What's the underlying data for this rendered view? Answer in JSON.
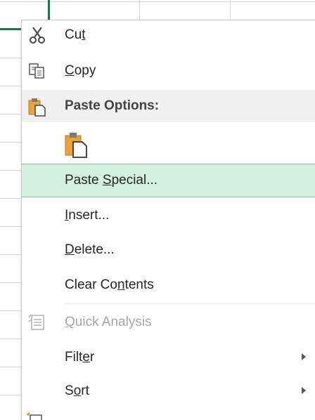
{
  "menu": {
    "items": [
      {
        "id": "cut",
        "pre": "Cu",
        "key": "t",
        "post": "",
        "icon": "scissors-icon"
      },
      {
        "id": "copy",
        "pre": "",
        "key": "C",
        "post": "opy",
        "icon": "copy-icon"
      },
      {
        "id": "paste_options",
        "pre": "Paste Options:",
        "key": "",
        "post": "",
        "icon": "clipboard-icon"
      },
      {
        "id": "paste_special",
        "pre": "Paste ",
        "key": "S",
        "post": "pecial...",
        "icon": ""
      },
      {
        "id": "insert",
        "pre": "",
        "key": "I",
        "post": "nsert...",
        "icon": ""
      },
      {
        "id": "delete",
        "pre": "",
        "key": "D",
        "post": "elete...",
        "icon": ""
      },
      {
        "id": "clear_contents",
        "pre": "Clear Co",
        "key": "n",
        "post": "tents",
        "icon": ""
      },
      {
        "id": "quick_analysis",
        "pre": "",
        "key": "Q",
        "post": "uick Analysis",
        "icon": "quick-analysis-icon"
      },
      {
        "id": "filter",
        "pre": "Filt",
        "key": "e",
        "post": "r",
        "icon": ""
      },
      {
        "id": "sort",
        "pre": "S",
        "key": "o",
        "post": "rt",
        "icon": ""
      }
    ],
    "paste_button_icon": "paste-icon"
  },
  "colors": {
    "hover_bg": "#d3f0e0",
    "selection_green": "#217346",
    "clipboard_orange": "#e8a33d"
  }
}
